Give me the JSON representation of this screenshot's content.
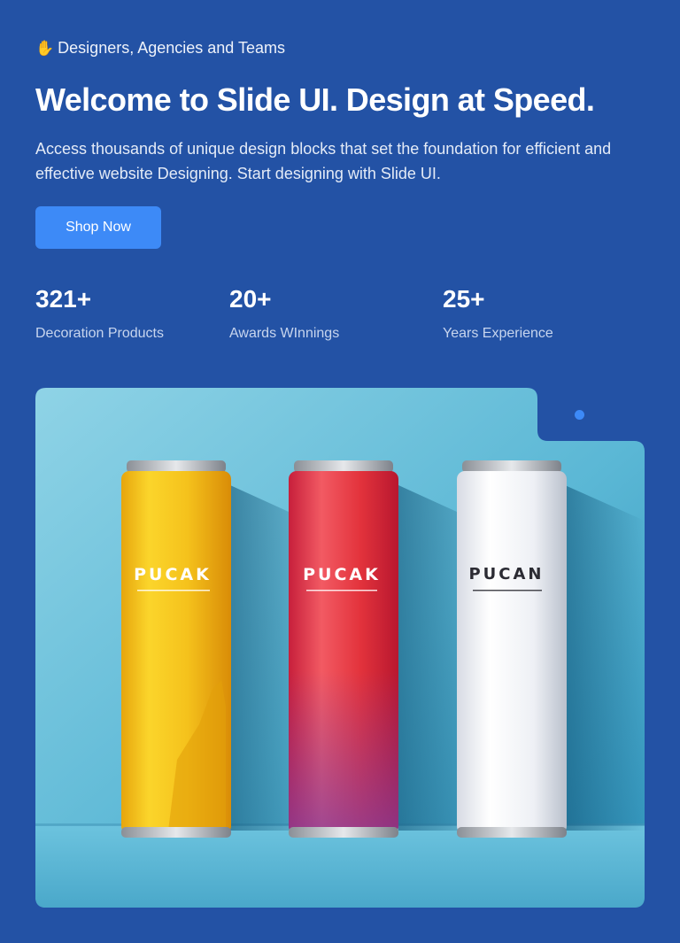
{
  "hero": {
    "eyebrow_icon": "waving-hand-icon",
    "eyebrow": "Designers, Agencies and Teams",
    "title": "Welcome to Slide UI. Design at Speed.",
    "description": "Access thousands of unique design blocks that set the foundation for efficient and effective website Designing. Start designing with Slide UI.",
    "cta_label": "Shop Now"
  },
  "stats": [
    {
      "value": "321+",
      "label": "Decoration Products"
    },
    {
      "value": "20+",
      "label": "Awards WInnings"
    },
    {
      "value": "25+",
      "label": "Years Experience"
    }
  ],
  "product_image": {
    "cans": [
      {
        "label": "PUCAK",
        "color": "#f2c21b"
      },
      {
        "label": "PUCAK",
        "color": "#e8343c"
      },
      {
        "label": "PUCAN",
        "color": "#eef0f4"
      }
    ]
  },
  "colors": {
    "background": "#2352a5",
    "accent": "#3d8af7",
    "image_backdrop": "#56b4d3"
  }
}
